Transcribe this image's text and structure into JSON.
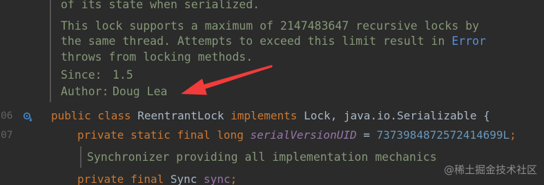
{
  "editor": {
    "gutter": {
      "line_numbers": [
        "06",
        "07"
      ]
    },
    "class_doc": {
      "lines": [
        "of its state when serialized.",
        "This lock supports a maximum of 2147483647 recursive locks by",
        "the same thread. Attempts to exceed this limit result in",
        "throws from locking methods."
      ],
      "link_text": "Error",
      "since_label": "Since:",
      "since_value": "1.5",
      "author_label": "Author:",
      "author_value": "Doug Lea"
    },
    "class_declaration": {
      "keyword": "public class",
      "name": "ReentrantLock",
      "implements_keyword": "implements",
      "interfaces": "Lock, java.io.Serializable {"
    },
    "serial_field": {
      "modifiers": "private static final long",
      "name": "serialVersionUID",
      "operator": "=",
      "value": "7373984872572414699L",
      "terminator": ";"
    },
    "sync_doc": {
      "text": "Synchronizer providing all implementation mechanics"
    },
    "sync_field": {
      "modifiers": "private final",
      "type": "Sync",
      "name": "sync",
      "terminator": ";"
    }
  },
  "watermark": {
    "text": "@稀土掘金技术社区"
  },
  "icons": {
    "gutter": "implemented-by-subclasses-icon",
    "annotation": "red-arrow-icon"
  },
  "colors": {
    "background": "#2B2B2B",
    "keyword": "#CC7832",
    "identifier": "#A9B7C6",
    "static_field": "#9876AA",
    "number": "#6897BB",
    "doc_text": "#859877",
    "link": "#5C8FD8",
    "line_number": "#606366",
    "gutter_icon": "#3E8BD1",
    "annotation_arrow": "#F23B3B"
  }
}
